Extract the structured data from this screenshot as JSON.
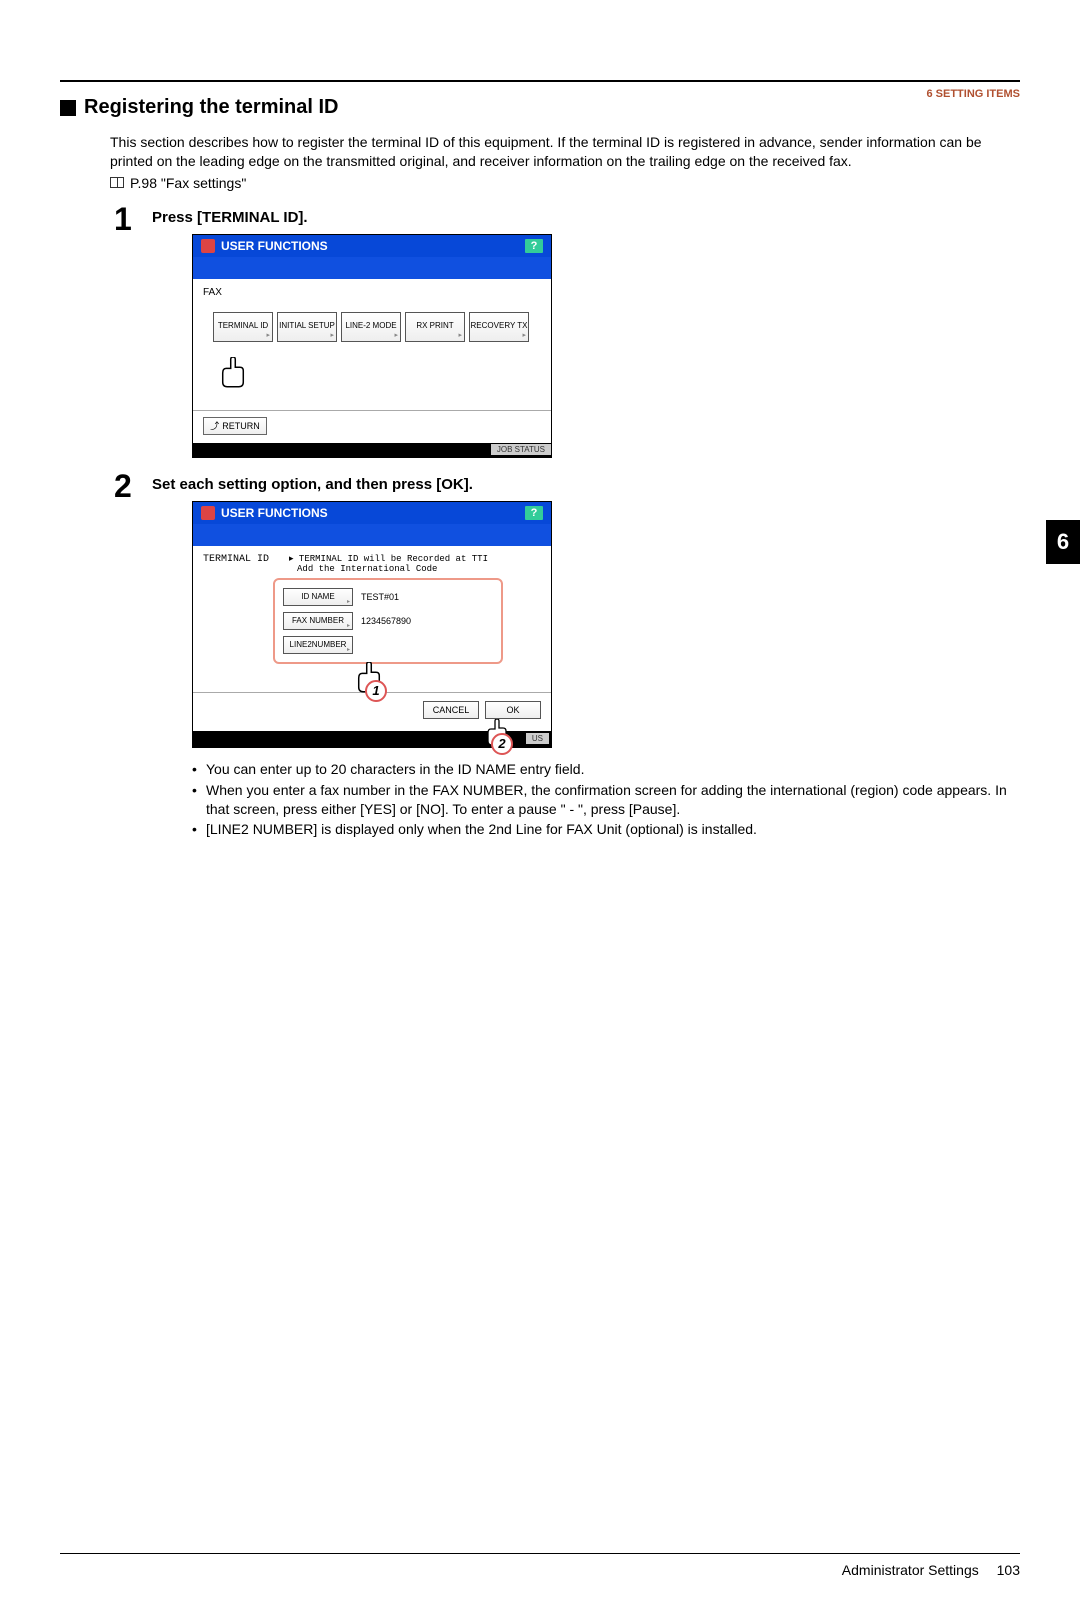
{
  "header": {
    "chapter_num": "6",
    "chapter_title": "SETTING ITEMS"
  },
  "side_tab": "6",
  "section": {
    "title": "Registering the terminal ID",
    "intro": "This section describes how to register the terminal ID of this equipment. If the terminal ID is registered in advance, sender information can be printed on the leading edge on the transmitted original, and receiver information on the trailing edge on the received fax.",
    "ref": "P.98 \"Fax settings\""
  },
  "steps": [
    {
      "num": "1",
      "title": "Press [TERMINAL ID].",
      "screenshot": {
        "header_label": "USER FUNCTIONS",
        "help": "?",
        "body_label": "FAX",
        "buttons": [
          "TERMINAL ID",
          "INITIAL SETUP",
          "LINE-2 MODE",
          "RX PRINT",
          "RECOVERY TX"
        ],
        "return_label": "RETURN",
        "status": "JOB STATUS"
      }
    },
    {
      "num": "2",
      "title": "Set each setting option, and then press [OK].",
      "screenshot": {
        "header_label": "USER FUNCTIONS",
        "help": "?",
        "screen_label": "TERMINAL ID",
        "msg_line1": "▸ TERMINAL ID will be Recorded at TTI",
        "msg_line2": "Add the International Code",
        "fields": [
          {
            "label": "ID NAME",
            "value": "TEST#01"
          },
          {
            "label": "FAX NUMBER",
            "value": "1234567890"
          },
          {
            "label": "LINE2NUMBER",
            "value": ""
          }
        ],
        "cancel": "CANCEL",
        "ok": "OK",
        "status_us": "US"
      },
      "bullets": [
        "You can enter up to 20 characters in the ID NAME entry field.",
        "When you enter a fax number in the FAX NUMBER, the confirmation screen for adding the international (region) code appears. In that screen, press either [YES] or [NO]. To enter a pause \" - \", press [Pause].",
        "[LINE2 NUMBER] is displayed only when the 2nd Line for FAX Unit (optional) is installed."
      ]
    }
  ],
  "callouts": {
    "c1": "1",
    "c2": "2"
  },
  "footer": {
    "section": "Administrator Settings",
    "page": "103"
  }
}
